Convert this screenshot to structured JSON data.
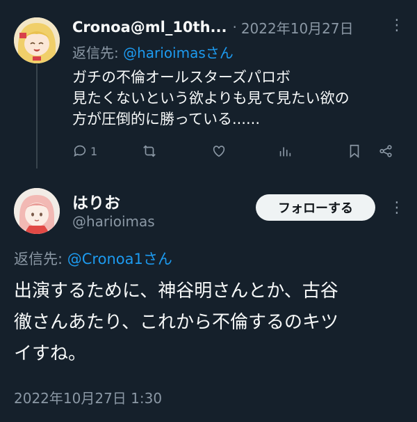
{
  "reply_tweet": {
    "author_name": "Cronoa@ml_10th...",
    "separator": "·",
    "date": "2022年10月27日",
    "replying_prefix": "返信先: ",
    "replying_to": "@harioimasさん",
    "text_lines": [
      "ガチの不倫オールスターズパロボ",
      "見たくないという欲よりも見て見たい欲の",
      "方が圧倒的に勝っている......"
    ],
    "reply_count": "1",
    "more_icon": "⋮"
  },
  "main_tweet": {
    "author_name": "はりお",
    "handle": "@harioimas",
    "follow_label": "フォローする",
    "more_icon": "⋮",
    "replying_prefix": "返信先: ",
    "replying_to": "@Cronoa1さん",
    "text_lines": [
      "出演するために、神谷明さんとか、古谷",
      "徹さんあたり、これから不倫するのキツ",
      "イすね。"
    ],
    "timestamp": "2022年10月27日 1:30"
  },
  "icons": [
    "reply-icon",
    "retweet-icon",
    "like-icon",
    "views-icon",
    "bookmark-icon",
    "share-icon",
    "more-icon"
  ],
  "colors": {
    "background": "#15202b",
    "secondary_text": "#8b98a5",
    "link": "#1d9bf0",
    "follow_button": "#eff3f4"
  }
}
